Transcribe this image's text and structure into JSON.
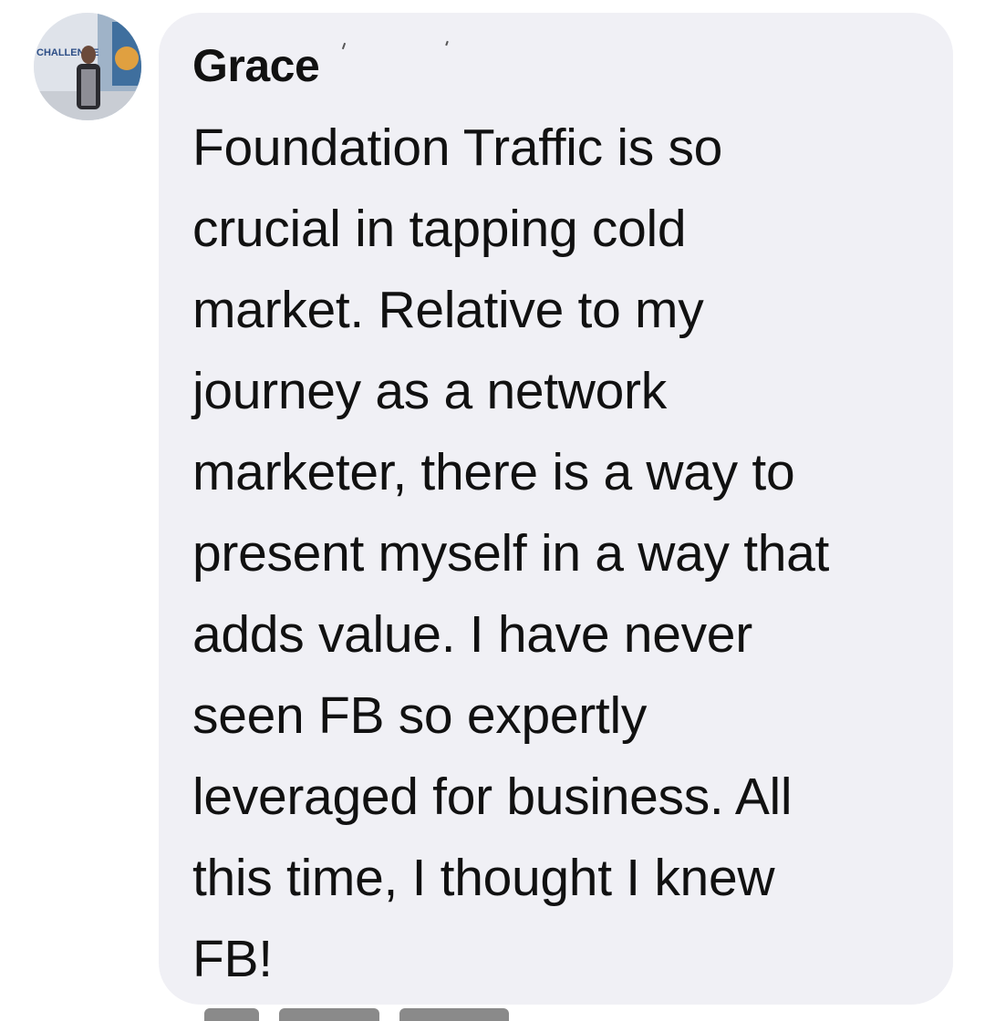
{
  "comment": {
    "author": "Grace",
    "avatar_text": "CHALLENGE",
    "lines": [
      "Foundation Traffic is so",
      "crucial in tapping cold",
      "market. Relative to my",
      "journey as a network",
      "marketer, there is a way to",
      "present myself in a way that",
      "adds value. I have never",
      "seen FB so expertly",
      "leveraged for business. All",
      "this time, I thought I knew",
      "FB!"
    ]
  }
}
